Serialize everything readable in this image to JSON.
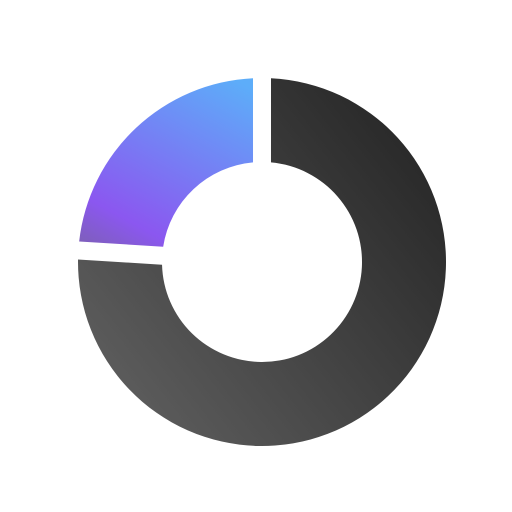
{
  "progress_ring": {
    "icon": "progress-ring-icon",
    "progress_fraction": 0.24,
    "colors": {
      "background": "#ffffff",
      "progress_start": "#5dadf9",
      "progress_mid": "#8b57f0",
      "progress_end": "#6a6a6a",
      "track_light": "#5c5c5c",
      "track_dark": "#2b2b2b"
    }
  }
}
